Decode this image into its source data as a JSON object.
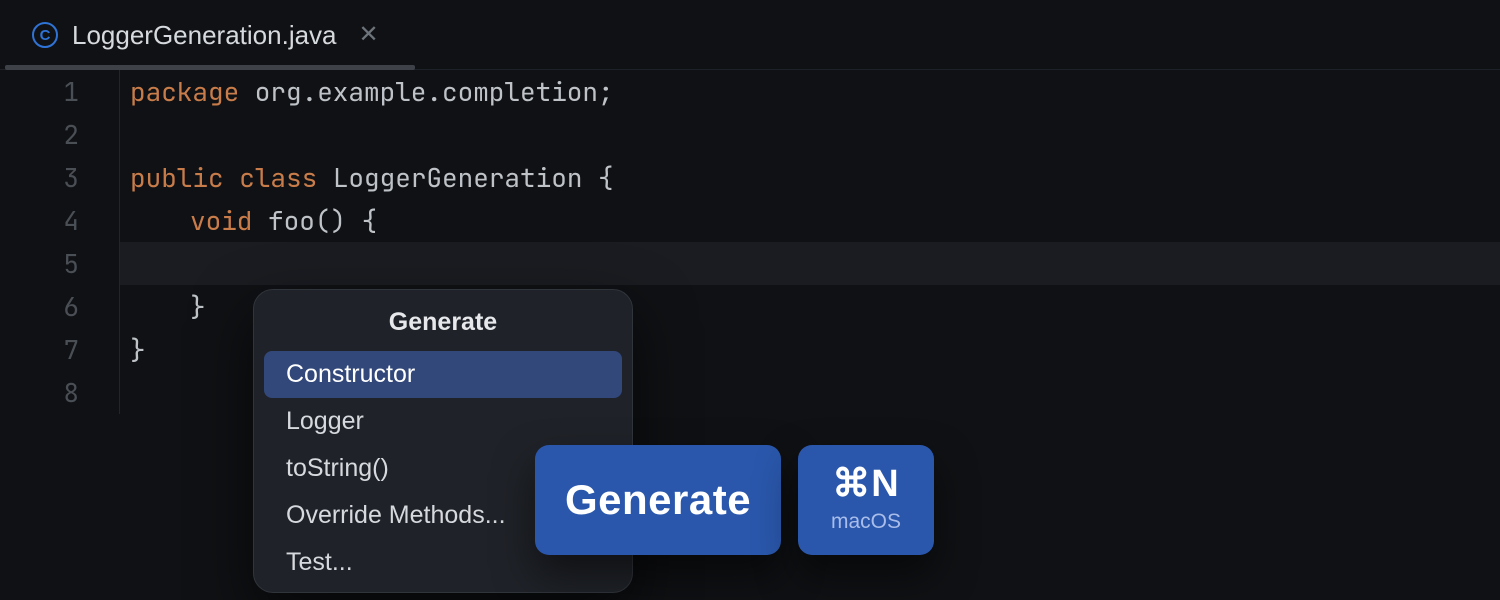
{
  "tab": {
    "filename": "LoggerGeneration.java",
    "icon": "class-icon"
  },
  "gutter": [
    "1",
    "2",
    "3",
    "4",
    "5",
    "6",
    "7",
    "8"
  ],
  "code": {
    "l1_kw": "package",
    "l1_rest": " org.example.completion;",
    "l3_kw1": "public",
    "l3_kw2": "class",
    "l3_cls": " LoggerGeneration ",
    "l3_brace": "{",
    "l4_kw": "void",
    "l4_fn": " foo() ",
    "l4_brace": "{",
    "l6_brace": "}",
    "l7_brace": "}"
  },
  "popup": {
    "title": "Generate",
    "items": [
      "Constructor",
      "Logger",
      "toString()",
      "Override Methods...",
      "Test..."
    ],
    "selectedIndex": 0
  },
  "tooltip": {
    "label": "Generate",
    "shortcut": "⌘N",
    "os": "macOS"
  }
}
